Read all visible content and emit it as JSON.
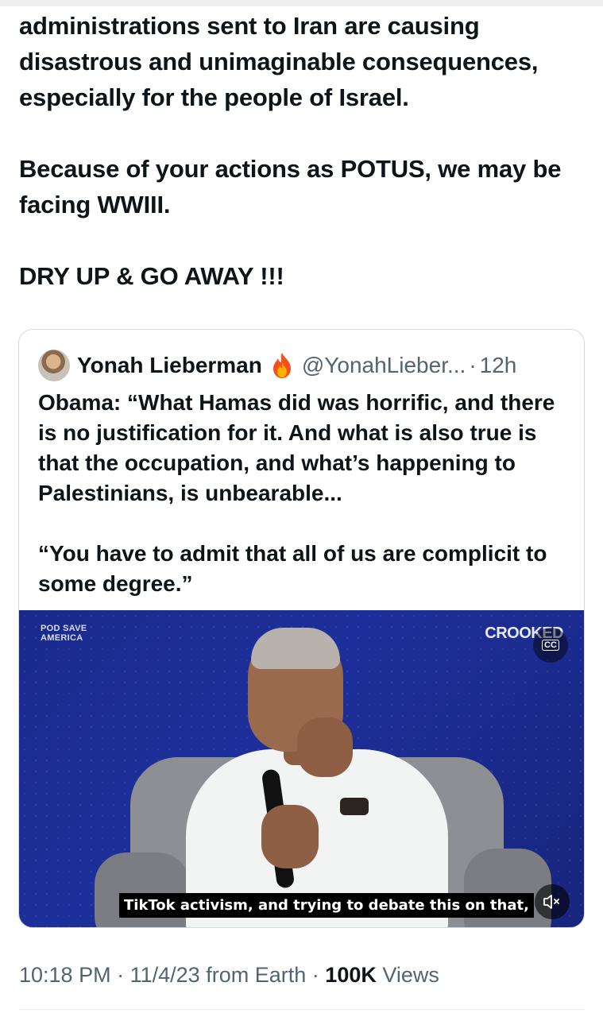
{
  "tweet": {
    "paragraphs": [
      "administrations sent to Iran are causing disastrous and unimaginable consequences, especially for the people of Israel.",
      "Because of your actions as POTUS, we may be facing WWIII.",
      "DRY UP & GO AWAY !!!"
    ]
  },
  "quote": {
    "author_name": "Yonah Lieberman",
    "author_emoji": "fire-emoji-icon",
    "handle": "@YonahLieber...",
    "separator": "·",
    "time": "12h",
    "paragraphs": [
      "Obama: “What Hamas did was horrific, and there is no justification for it. And what is also true is that the occupation, and what’s happening to Palestinians, is unbearable...",
      "“You have to admit that all of us are complicit to some degree.”"
    ]
  },
  "video": {
    "logo_left_line1": "POD SAVE",
    "logo_left_line2": "AMERICA",
    "logo_right": "CROOKED",
    "caption": "TikTok activism, and trying to debate this on that,",
    "cc_label": "CC",
    "background_color": "#1d2f9a"
  },
  "meta": {
    "timestamp": "10:18 PM",
    "separator": "·",
    "date": "11/4/23",
    "source": "from Earth",
    "views_count": "100K",
    "views_label": "Views"
  }
}
